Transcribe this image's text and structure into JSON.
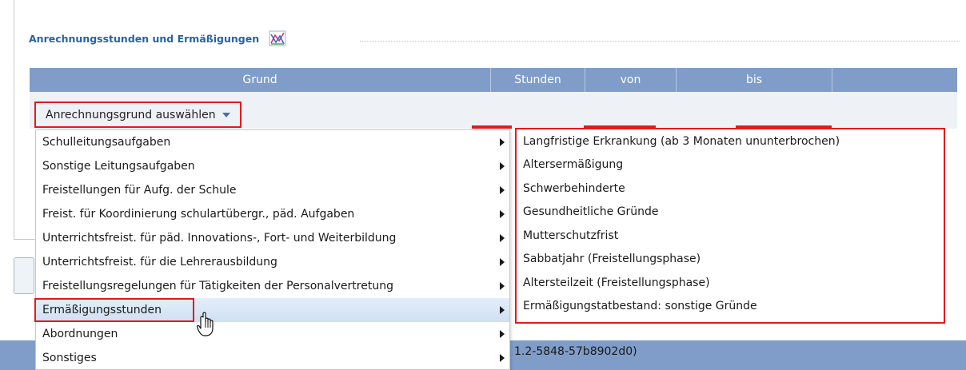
{
  "section": {
    "title": "Anrechnungsstunden und Ermäßigungen"
  },
  "table": {
    "headers": [
      "Grund",
      "Stunden",
      "von",
      "bis",
      ""
    ]
  },
  "select": {
    "label": "Anrechnungsgrund auswählen"
  },
  "menu": {
    "items": [
      {
        "label": "Schulleitungsaufgaben"
      },
      {
        "label": "Sonstige Leitungsaufgaben"
      },
      {
        "label": "Freistellungen für Aufg. der Schule"
      },
      {
        "label": "Freist. für Koordinierung schulartübergr., päd. Aufgaben"
      },
      {
        "label": "Unterrichtsfreist. für päd. Innovations-, Fort- und Weiterbildung"
      },
      {
        "label": "Unterrichtsfreist. für die Lehrerausbildung"
      },
      {
        "label": "Freistellungsregelungen für Tätigkeiten der Personalvertretung"
      },
      {
        "label": "Ermäßigungsstunden"
      },
      {
        "label": "Abordnungen"
      },
      {
        "label": "Sonstiges"
      }
    ]
  },
  "submenu": {
    "items": [
      {
        "label": "Langfristige Erkrankung (ab 3 Monaten ununterbrochen)"
      },
      {
        "label": "Altersermäßigung"
      },
      {
        "label": "Schwerbehinderte"
      },
      {
        "label": "Gesundheitliche Gründe"
      },
      {
        "label": "Mutterschutzfrist"
      },
      {
        "label": "Sabbatjahr (Freistellungsphase)"
      },
      {
        "label": "Altersteilzeit (Freistellungsphase)"
      },
      {
        "label": "Ermäßigungstatbestand: sonstige Gründe"
      }
    ]
  },
  "footer": {
    "text": "1.2-5848-57b8902d0)"
  },
  "colors": {
    "accent": "#7f9dc8",
    "highlight": "#e21a1a",
    "title": "#2563a6"
  },
  "icons": {
    "chart": "chart-icon",
    "cursor": "hand-pointer-icon"
  }
}
